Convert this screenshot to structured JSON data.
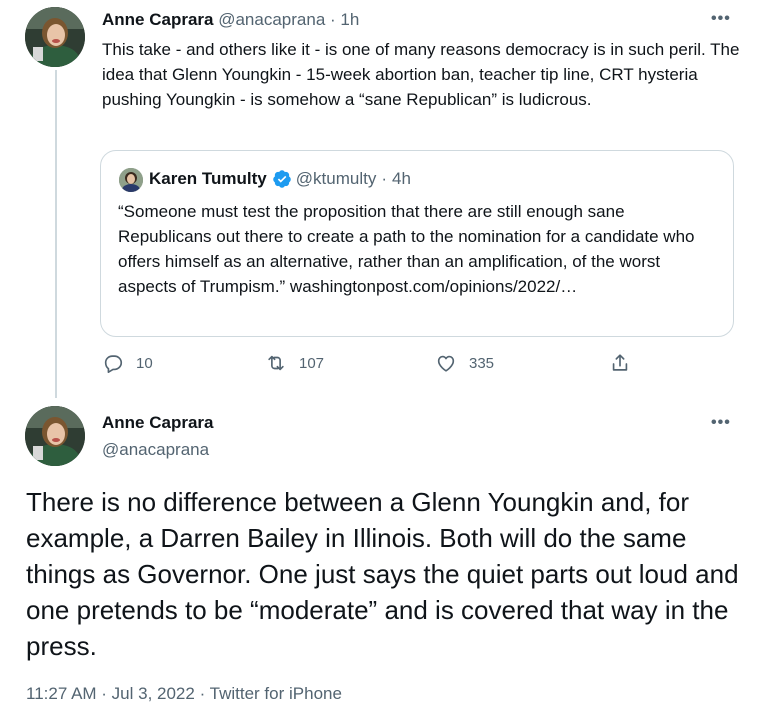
{
  "tweet1": {
    "author_name": "Anne Caprara",
    "author_handle": "@anacaprana",
    "separator": "·",
    "time_ago": "1h",
    "more_label": "•••",
    "text": "This take - and others like it - is one of many reasons democracy is in such peril.  The idea that Glenn Youngkin - 15-week abortion ban, teacher tip line, CRT hysteria pushing Youngkin - is somehow a “sane Republican” is ludicrous.",
    "quote": {
      "author_name": "Karen Tumulty",
      "author_handle": "@ktumulty",
      "separator": "·",
      "time_ago": "4h",
      "text": "“Someone must test the proposition that there are still enough sane Republicans out there to create a path to the nomination for a candidate who offers himself as an alternative, rather than an amplification, of the worst aspects of Trumpism.” washingtonpost.com/opinions/2022/…"
    },
    "actions": {
      "replies": "10",
      "retweets": "107",
      "likes": "335"
    }
  },
  "tweet2": {
    "author_name": "Anne Caprara",
    "author_handle": "@anacaprana",
    "more_label": "•••",
    "text": "There is no difference between a Glenn Youngkin and, for example, a Darren Bailey in Illinois.  Both will do the same things as Governor. One just says the quiet parts out loud and one pretends to be “moderate” and is covered that way in the press.",
    "timestamp": "11:27 AM · Jul 3, 2022 · Twitter for iPhone"
  },
  "colors": {
    "text_primary": "#0f1419",
    "text_secondary": "#536471",
    "border": "#cfd9de",
    "verified_blue": "#1d9bf0"
  },
  "icons": [
    "reply-icon",
    "retweet-icon",
    "like-icon",
    "share-icon",
    "verified-badge-icon",
    "more-icon"
  ]
}
